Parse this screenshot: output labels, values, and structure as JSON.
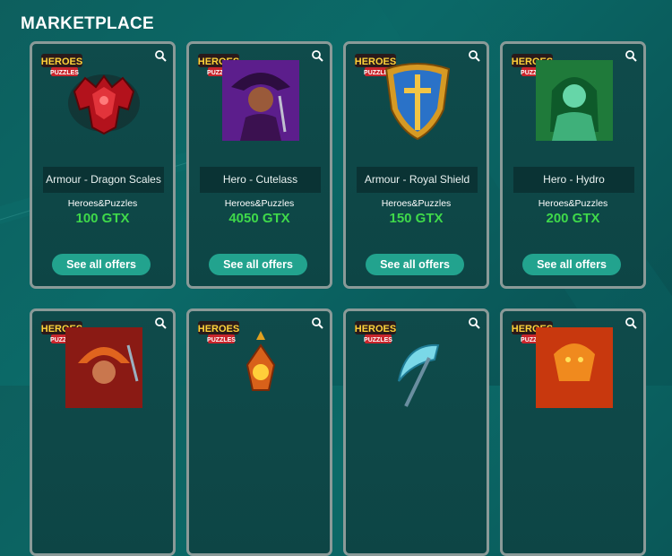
{
  "page": {
    "title": "MARKETPLACE"
  },
  "brand_logo": {
    "line1": "HEROES",
    "line2": "PUZZLES"
  },
  "colors": {
    "price": "#3fd94a",
    "button": "#22a38e",
    "card_border": "#8a9a98"
  },
  "cards": [
    {
      "name": "Armour - Dragon Scales",
      "publisher": "Heroes&Puzzles",
      "price": "100 GTX",
      "button": "See all offers",
      "image_icon": "dragon-scales-armour-icon"
    },
    {
      "name": "Hero - Cutelass",
      "publisher": "Heroes&Puzzles",
      "price": "4050 GTX",
      "button": "See all offers",
      "image_icon": "hero-cutelass-portrait"
    },
    {
      "name": "Armour - Royal Shield",
      "publisher": "Heroes&Puzzles",
      "price": "150 GTX",
      "button": "See all offers",
      "image_icon": "royal-shield-icon"
    },
    {
      "name": "Hero - Hydro",
      "publisher": "Heroes&Puzzles",
      "price": "200 GTX",
      "button": "See all offers",
      "image_icon": "hero-hydro-portrait"
    },
    {
      "image_icon": "hero-red-warrior-portrait"
    },
    {
      "image_icon": "fire-amulet-icon"
    },
    {
      "image_icon": "ice-scythe-icon"
    },
    {
      "image_icon": "hero-fire-dragon-portrait"
    }
  ]
}
